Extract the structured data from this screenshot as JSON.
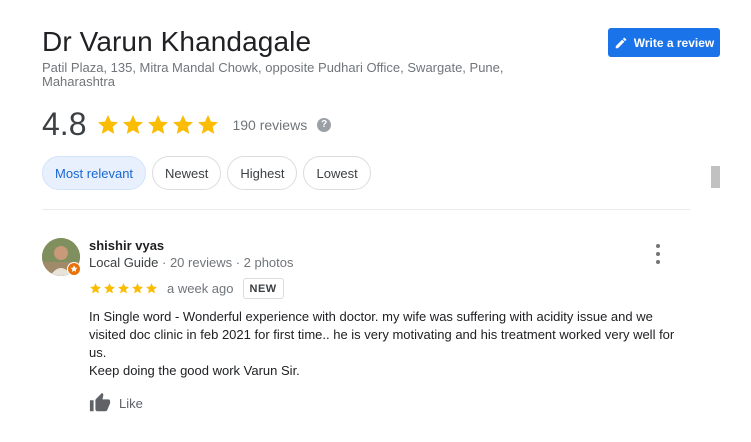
{
  "place": {
    "name": "Dr Varun Khandagale",
    "address": "Patil Plaza, 135, Mitra Mandal Chowk, opposite Pudhari Office, Swargate, Pune, Maharashtra"
  },
  "write_review_label": "Write a review",
  "rating": {
    "value": "4.8",
    "stars": 5,
    "count_label": "190 reviews",
    "help_glyph": "?"
  },
  "filters": [
    {
      "label": "Most relevant",
      "active": true
    },
    {
      "label": "Newest",
      "active": false
    },
    {
      "label": "Highest",
      "active": false
    },
    {
      "label": "Lowest",
      "active": false
    }
  ],
  "review": {
    "author": "shishir vyas",
    "guide_label": "Local Guide",
    "stats": " · 20 reviews · 2 photos",
    "stars": 5,
    "time": "a week ago",
    "badge": "NEW",
    "text_line1": "In Single word - Wonderful experience with doctor. my wife was suffering with acidity issue and we visited doc clinic in feb 2021 for first time.. he is very motivating and his treatment worked very well for us.",
    "text_line2": "Keep doing the good work Varun Sir.",
    "like_label": "Like"
  },
  "colors": {
    "accent": "#1a73e8",
    "star": "#fbbc04",
    "guide_badge": "#e8710a",
    "chip_active_bg": "#e8f0fe"
  },
  "icons": [
    "pencil-icon",
    "star-icon",
    "help-icon",
    "more-vert-icon",
    "thumb-up-icon",
    "local-guide-icon"
  ]
}
